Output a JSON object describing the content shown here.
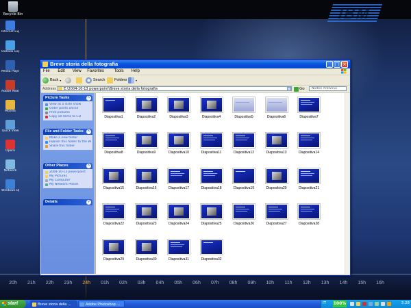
{
  "desktop": {
    "recycle_bin": "Recycle Bin",
    "logo_text": "IBM",
    "icons": [
      {
        "label": "Internet Explorer"
      },
      {
        "label": "Outlook Express"
      },
      {
        "label": "Media Player"
      },
      {
        "label": "Adobe Reader"
      },
      {
        "label": "Mozilla"
      },
      {
        "label": "Quick View"
      },
      {
        "label": "Opera"
      },
      {
        "label": "Network"
      },
      {
        "label": "Windows Update"
      }
    ],
    "timeline_hours": [
      "20h",
      "21h",
      "22h",
      "23h",
      "24h",
      "01h",
      "02h",
      "03h",
      "04h",
      "05h",
      "06h",
      "07h",
      "08h",
      "09h",
      "10h",
      "11h",
      "12h",
      "13h",
      "14h",
      "15h",
      "16h"
    ],
    "current_hour": "24h"
  },
  "window": {
    "title": "Breve storia della fotografia",
    "menu": [
      "File",
      "Edit",
      "View",
      "Favorites",
      "Tools",
      "Help"
    ],
    "toolbar": {
      "back": "Back",
      "search": "Search",
      "folders": "Folders"
    },
    "address": {
      "label": "Address",
      "path": "E:\\2004-10-13 powerpoint\\Breve storia della fotografia",
      "go": "Go",
      "links": "Norton AntiVirus"
    },
    "taskpane": {
      "picture_tasks": {
        "title": "Picture Tasks",
        "items": [
          "View as a slide show",
          "Order prints online",
          "Print pictures",
          "Copy all items to CD"
        ]
      },
      "file_folder_tasks": {
        "title": "File and Folder Tasks",
        "items": [
          "Make a new folder",
          "Publish this folder to the Web",
          "Share this folder"
        ]
      },
      "other_places": {
        "title": "Other Places",
        "items": [
          "2004-10-13 powerpoint",
          "My Pictures",
          "My Computer",
          "My Network Places"
        ]
      },
      "details": {
        "title": "Details"
      }
    },
    "thumbnails": [
      {
        "label": "Diapositiva1",
        "style": "title"
      },
      {
        "label": "Diapositiva2",
        "style": "photo"
      },
      {
        "label": "Diapositiva3",
        "style": "photo"
      },
      {
        "label": "Diapositiva4",
        "style": "photo"
      },
      {
        "label": "Diapositiva5",
        "style": "light"
      },
      {
        "label": "Diapositiva6",
        "style": "light"
      },
      {
        "label": "Diapositiva7",
        "style": "text"
      },
      {
        "label": "Diapositiva8",
        "style": "text"
      },
      {
        "label": "Diapositiva9",
        "style": "photo"
      },
      {
        "label": "Diapositiva10",
        "style": "photo"
      },
      {
        "label": "Diapositiva11",
        "style": "text"
      },
      {
        "label": "Diapositiva12",
        "style": "text"
      },
      {
        "label": "Diapositiva13",
        "style": "photo"
      },
      {
        "label": "Diapositiva14",
        "style": "text"
      },
      {
        "label": "Diapositiva15",
        "style": "photo"
      },
      {
        "label": "Diapositiva16",
        "style": "photo"
      },
      {
        "label": "Diapositiva17",
        "style": "text"
      },
      {
        "label": "Diapositiva18",
        "style": "text"
      },
      {
        "label": "Diapositiva19",
        "style": "title"
      },
      {
        "label": "Diapositiva20",
        "style": "photo"
      },
      {
        "label": "Diapositiva21",
        "style": "text"
      },
      {
        "label": "Diapositiva22",
        "style": "text"
      },
      {
        "label": "Diapositiva23",
        "style": "photo"
      },
      {
        "label": "Diapositiva24",
        "style": "photo"
      },
      {
        "label": "Diapositiva25",
        "style": "photo"
      },
      {
        "label": "Diapositiva26",
        "style": "text"
      },
      {
        "label": "Diapositiva27",
        "style": "text"
      },
      {
        "label": "Diapositiva28",
        "style": "text"
      },
      {
        "label": "Diapositiva29",
        "style": "photo"
      },
      {
        "label": "Diapositiva30",
        "style": "photo"
      },
      {
        "label": "Diapositiva31",
        "style": "text"
      },
      {
        "label": "Diapositiva32",
        "style": "title"
      }
    ]
  },
  "taskbar": {
    "start": "start",
    "buttons": [
      {
        "label": "Breve storia della ..."
      },
      {
        "label": "Adobe Photoshop ..."
      }
    ],
    "tray": {
      "lang": "IT",
      "battery": "100%",
      "clock": "3.28"
    }
  },
  "colors": {
    "titlebar": "#0a58e0",
    "taskbar": "#245edb",
    "start_button": "#2e8a2e",
    "slide_blue": "#1a33c8"
  }
}
